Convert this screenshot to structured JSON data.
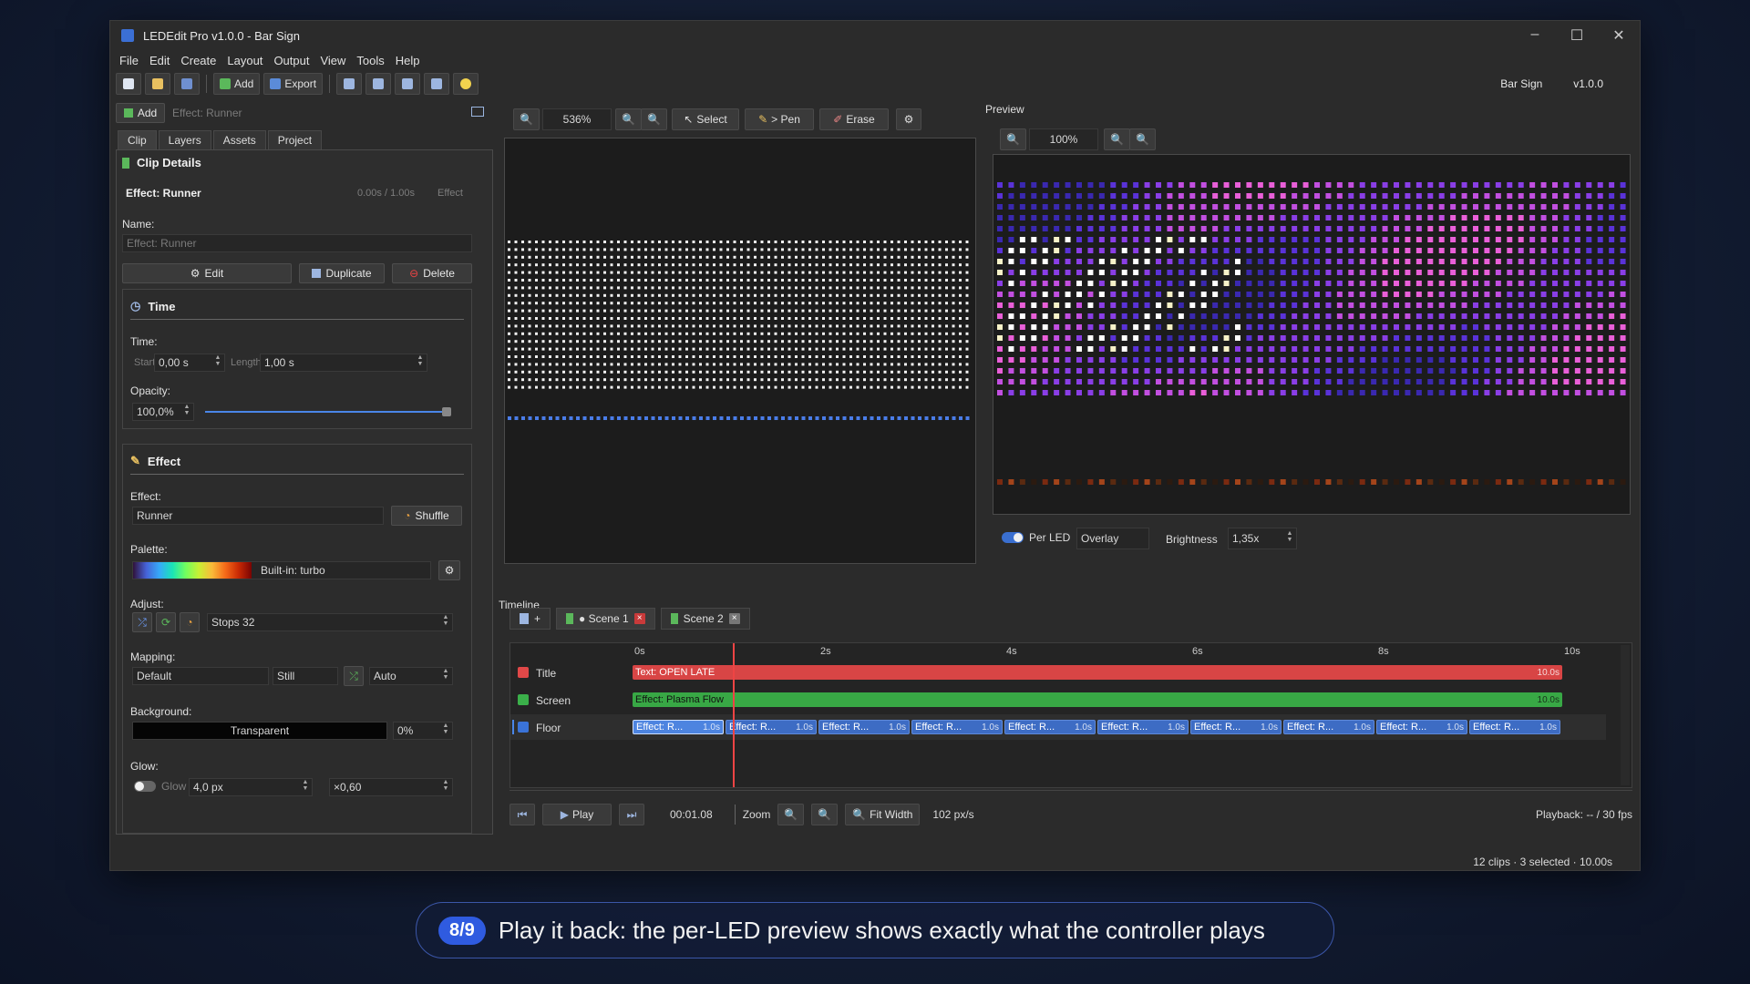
{
  "window": {
    "title": "LEDEdit Pro v1.0.0 - Bar Sign",
    "controls": [
      "–",
      "☐",
      "✕"
    ]
  },
  "menu": [
    "File",
    "Edit",
    "Create",
    "Layout",
    "Output",
    "View",
    "Tools",
    "Help"
  ],
  "toolbar": {
    "add_label": "Add",
    "export_label": "Export",
    "project_name": "Bar Sign",
    "version": "v1.0.0"
  },
  "left": {
    "add_label": "Add",
    "add_hint": "Effect: Runner",
    "tabs": [
      "Clip",
      "Layers",
      "Assets",
      "Project"
    ],
    "clip_details_title": "Clip Details",
    "effect_heading": "Effect: Runner",
    "effect_time": "0.00s / 1.00s",
    "effect_type": "Effect",
    "name_label": "Name:",
    "name_placeholder": "Effect: Runner",
    "edit_btn": "Edit",
    "duplicate_btn": "Duplicate",
    "delete_btn": "Delete",
    "time_section": "Time",
    "time_label": "Time:",
    "start_label": "Start",
    "start_value": "0,00 s",
    "length_label": "Length",
    "length_value": "1,00 s",
    "opacity_label": "Opacity:",
    "opacity_value": "100,0%",
    "opacity_fraction": 1.0,
    "effect_section": "Effect",
    "effect_label": "Effect:",
    "effect_value": "Runner",
    "shuffle_btn": "Shuffle",
    "palette_label": "Palette:",
    "palette_value": "Built-in: turbo",
    "adjust_label": "Adjust:",
    "stops_value": "Stops 32",
    "mapping_label": "Mapping:",
    "mapping_value": "Default",
    "mapping_mode": "Still",
    "mapping_auto": "Auto",
    "background_label": "Background:",
    "background_value": "Transparent",
    "background_pct": "0%",
    "glow_label": "Glow:",
    "glow_toggle": "Glow",
    "glow_px": "4,0 px",
    "glow_mult": "×0,60"
  },
  "editor": {
    "zoom": "536%",
    "select_btn": "Select",
    "pen_btn": "> Pen",
    "erase_btn": "Erase"
  },
  "preview": {
    "title": "Preview",
    "zoom": "100%",
    "per_led_label": "Per LED",
    "blend_mode": "Overlay",
    "brightness_label": "Brightness",
    "brightness_value": "1,35x"
  },
  "timeline": {
    "title": "Timeline",
    "add_scene": "+",
    "scenes": [
      {
        "label": "● Scene 1"
      },
      {
        "label": "Scene 2"
      }
    ],
    "ruler": [
      "0s",
      "2s",
      "4s",
      "6s",
      "8s",
      "10s"
    ],
    "tracks": [
      {
        "name": "Title",
        "color": "#e04848"
      },
      {
        "name": "Screen",
        "color": "#3bb04a"
      },
      {
        "name": "Floor",
        "color": "#3a73d8"
      }
    ],
    "title_clip": {
      "label": "Text: OPEN LATE",
      "len": "10.0s"
    },
    "screen_clip": {
      "label": "Effect: Plasma Flow",
      "len": "10.0s"
    },
    "floor_clips": [
      {
        "label": "Effect: R...",
        "len": "1.0s"
      },
      {
        "label": "Effect: R...",
        "len": "1.0s"
      },
      {
        "label": "Effect: R...",
        "len": "1.0s"
      },
      {
        "label": "Effect: R...",
        "len": "1.0s"
      },
      {
        "label": "Effect: R...",
        "len": "1.0s"
      },
      {
        "label": "Effect: R...",
        "len": "1.0s"
      },
      {
        "label": "Effect: R...",
        "len": "1.0s"
      },
      {
        "label": "Effect: R...",
        "len": "1.0s"
      },
      {
        "label": "Effect: R...",
        "len": "1.0s"
      },
      {
        "label": "Effect: R...",
        "len": "1.0s"
      }
    ],
    "play_label": "Play",
    "time_display": "00:01.08",
    "zoom_label": "Zoom",
    "fit_width": "Fit Width",
    "px_per_s": "102 px/s",
    "playback": "Playback: -- / 30 fps",
    "status": "12 clips  ·  3 selected  ·  10.00s"
  },
  "caption": {
    "step": "8/9",
    "text": "Play it back: the per-LED preview shows exactly what the controller plays"
  }
}
